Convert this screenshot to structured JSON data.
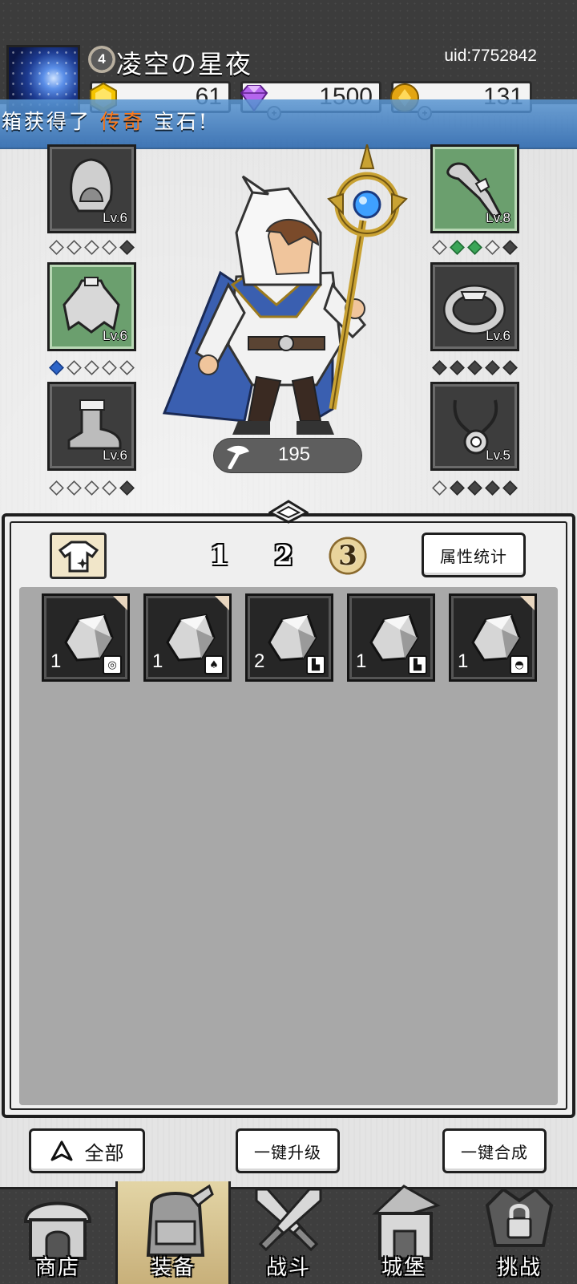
{
  "player": {
    "level": "4",
    "name": "凌空の星夜",
    "uid": "uid:7752842"
  },
  "resources": [
    {
      "name": "gem-coin",
      "value": "61",
      "color": "#f5c400"
    },
    {
      "name": "diamond",
      "value": "1500",
      "color": "#a64fe0"
    },
    {
      "name": "gold",
      "value": "131",
      "color": "#e3a512"
    }
  ],
  "banner": {
    "prefix": "箱获得了",
    "highlight": "传奇",
    "suffix": "宝石!",
    "highlight_color": "#ff7a1a"
  },
  "equipment": {
    "left": [
      {
        "item": "hood-icon",
        "level": "Lv.6",
        "gems": [
          "empty",
          "empty",
          "empty",
          "empty",
          "dark"
        ]
      },
      {
        "item": "cape-icon",
        "level": "Lv.6",
        "gems": [
          "blue",
          "empty",
          "empty",
          "empty",
          "empty"
        ]
      },
      {
        "item": "boot-icon",
        "level": "Lv.6",
        "gems": [
          "empty",
          "empty",
          "empty",
          "empty",
          "dark"
        ]
      }
    ],
    "right": [
      {
        "item": "bone-weapon-icon",
        "level": "Lv.8",
        "gems": [
          "empty",
          "green",
          "green",
          "empty",
          "dark"
        ]
      },
      {
        "item": "ring-icon",
        "level": "Lv.6",
        "gems": [
          "dark",
          "dark",
          "dark",
          "dark",
          "dark"
        ]
      },
      {
        "item": "necklace-icon",
        "level": "Lv.5",
        "gems": [
          "empty",
          "dark",
          "dark",
          "dark",
          "dark"
        ]
      }
    ]
  },
  "power": {
    "value": "195"
  },
  "inventory": {
    "tabs": [
      "1",
      "2",
      "3"
    ],
    "active_tab": "3",
    "stats_button": "属性统计",
    "items": [
      {
        "qty": "1",
        "slot_icon": "ring-icon"
      },
      {
        "qty": "1",
        "slot_icon": "armor-icon"
      },
      {
        "qty": "2",
        "slot_icon": "boot-icon"
      },
      {
        "qty": "1",
        "slot_icon": "boot-icon"
      },
      {
        "qty": "1",
        "slot_icon": "helmet-icon"
      }
    ]
  },
  "actions": {
    "filter": "全部",
    "upgrade_all": "一键升级",
    "merge_all": "一键合成"
  },
  "nav": [
    {
      "label": "商店",
      "icon": "shop-icon"
    },
    {
      "label": "装备",
      "icon": "backpack-icon",
      "active": true
    },
    {
      "label": "战斗",
      "icon": "crossed-swords-icon"
    },
    {
      "label": "城堡",
      "icon": "castle-icon"
    },
    {
      "label": "挑战",
      "icon": "locked-challenge-icon"
    }
  ]
}
